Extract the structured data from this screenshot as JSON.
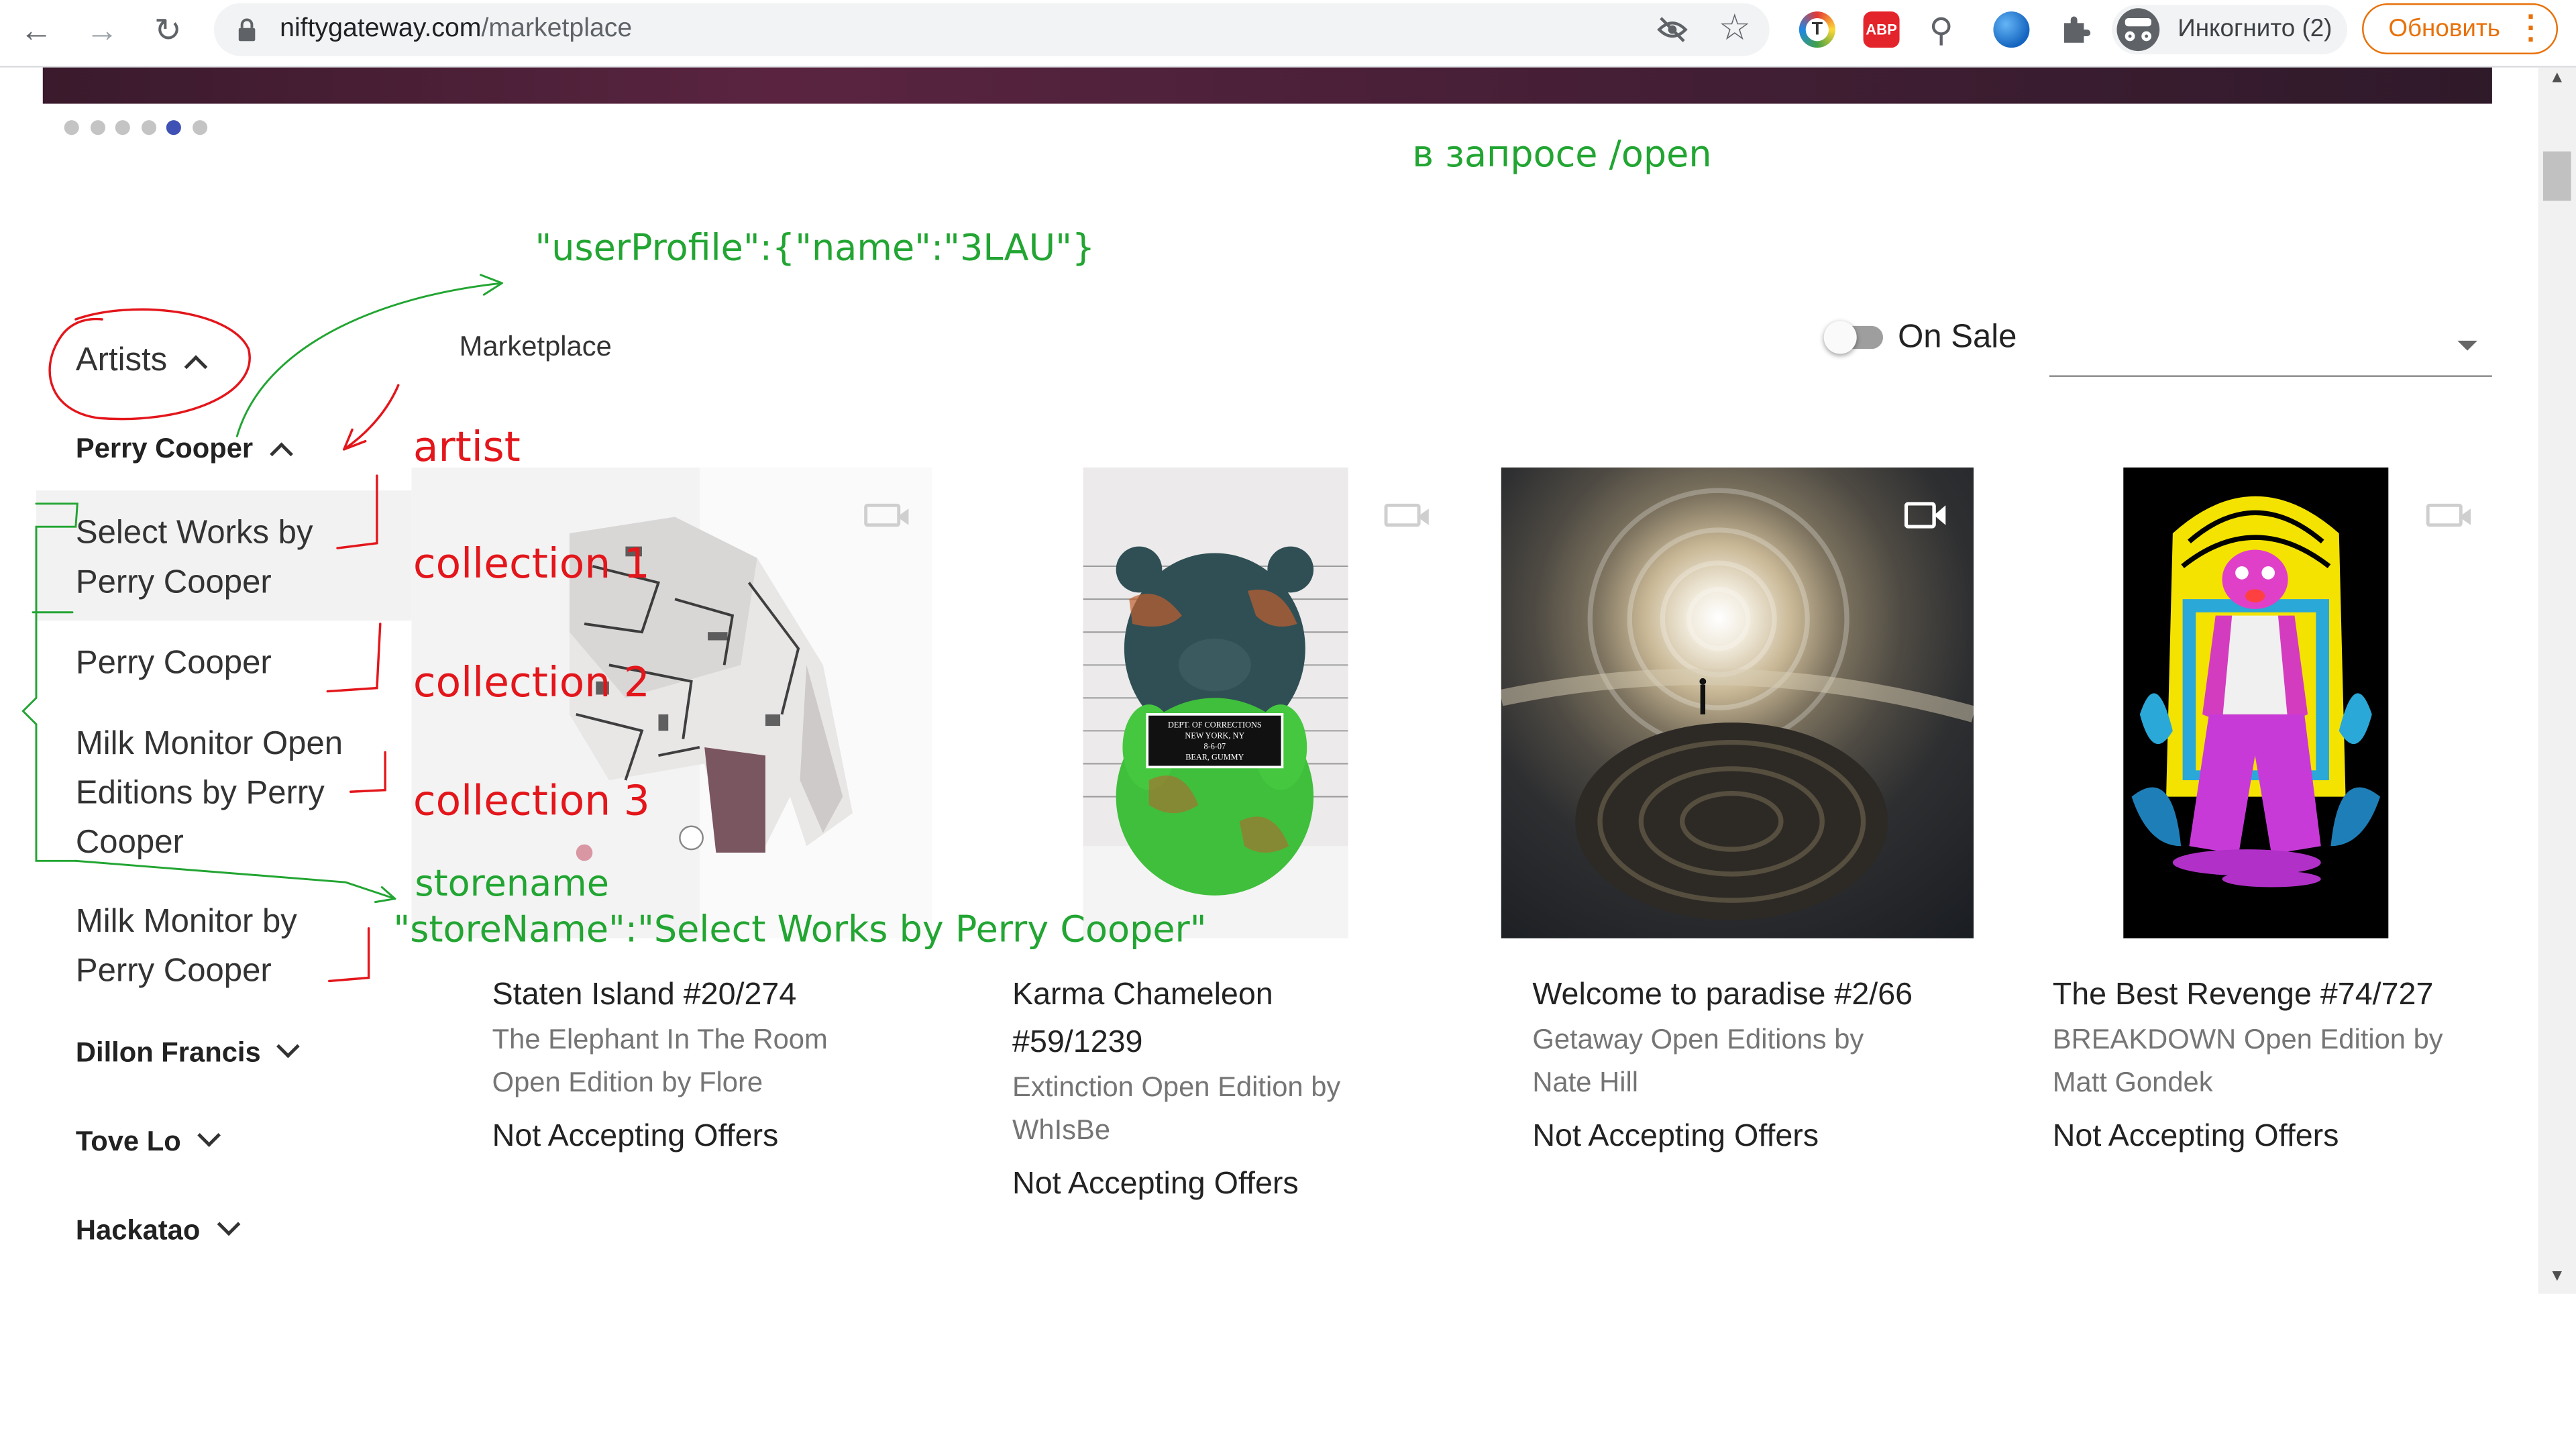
{
  "browser": {
    "url_host": "niftygateway.com",
    "url_path": "/marketplace",
    "incognito_label": "Инкогнито (2)",
    "update_label": "Обновить",
    "abp_label": "ABP"
  },
  "carousel": {
    "dot_count": 6,
    "active_index": 4
  },
  "sidebar": {
    "artists_label": "Artists",
    "artists": [
      {
        "name": "Perry Cooper",
        "expanded": true,
        "collections": [
          "Select Works by\nPerry Cooper",
          "Perry Cooper",
          "Milk Monitor Open\nEditions by Perry\nCooper",
          "Milk Monitor by\nPerry Cooper"
        ]
      },
      {
        "name": "Dillon Francis",
        "expanded": false
      },
      {
        "name": "Tove Lo",
        "expanded": false
      },
      {
        "name": "Hackatao",
        "expanded": false
      }
    ]
  },
  "main": {
    "heading": "Marketplace",
    "on_sale_label": "On Sale",
    "sort_value": ""
  },
  "cards": [
    {
      "title": "Staten Island #20/274",
      "subtitle": "The Elephant In The Room\nOpen Edition by Flore",
      "offer": "Not Accepting Offers"
    },
    {
      "title": "Karma Chameleon\n#59/1239",
      "subtitle": "Extinction Open Edition by\nWhIsBe",
      "offer": "Not Accepting Offers"
    },
    {
      "title": "Welcome to paradise #2/66",
      "subtitle": "Getaway Open Editions by\nNate Hill",
      "offer": "Not Accepting Offers"
    },
    {
      "title": "The Best Revenge #74/727",
      "subtitle": "BREAKDOWN Open Edition by\nMatt Gondek",
      "offer": "Not Accepting Offers"
    }
  ],
  "bear_sign": "DEPT. OF CORRECTIONS\nNEW YORK, NY\n8-6-07\nBEAR, GUMMY",
  "annotations": {
    "request": "в запросе /open",
    "user_profile": "\"userProfile\":{\"name\":\"3LAU\"}",
    "artist": "artist",
    "collection1": "collection 1",
    "collection2": "collection 2",
    "collection3": "collection 3",
    "storename": "storename",
    "store_name_value": "\"storeName\":\"Select Works by Perry Cooper\""
  },
  "colors": {
    "annotation_green": "#22a532",
    "annotation_red": "#e3161b",
    "update_orange": "#e8710a",
    "carousel_active": "#3f51b5"
  }
}
